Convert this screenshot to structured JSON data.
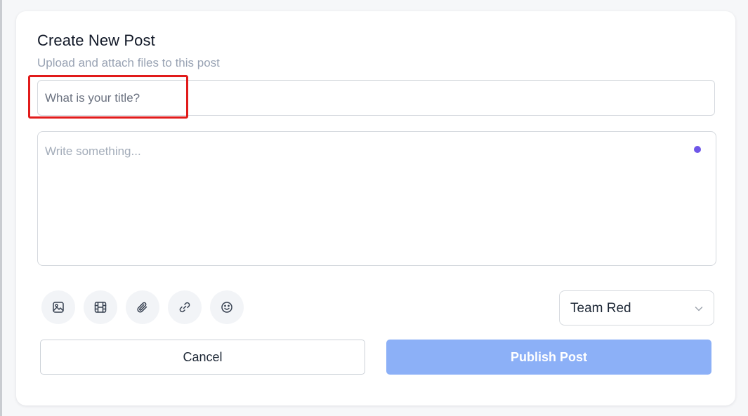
{
  "form": {
    "title": "Create New Post",
    "subtitle": "Upload and attach files to this post",
    "title_placeholder": "What is your title?",
    "body_placeholder": "Write something..."
  },
  "toolbar": {
    "icons": [
      "image-icon",
      "film-icon",
      "paperclip-icon",
      "link-icon",
      "emoji-icon"
    ]
  },
  "team_select": {
    "selected": "Team Red"
  },
  "actions": {
    "cancel_label": "Cancel",
    "publish_label": "Publish Post"
  },
  "colors": {
    "accent": "#8cb0f7",
    "indicator": "#6e56e8",
    "highlight": "#e11b1b"
  }
}
